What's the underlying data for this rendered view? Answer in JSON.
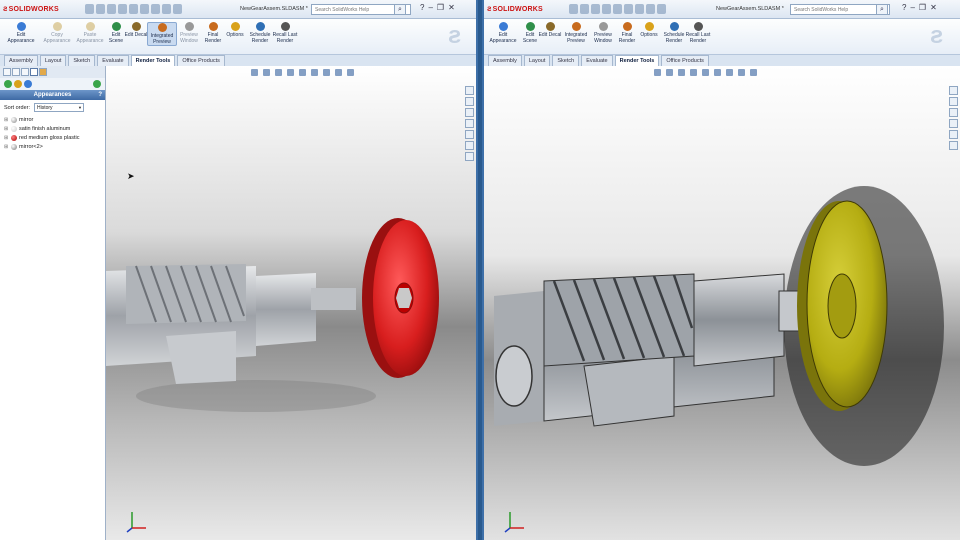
{
  "left": {
    "brand": "SOLIDWORKS",
    "doc_title": "NewGearAssem.SLDASM *",
    "search_placeholder": "Search SolidWorks Help",
    "ribbon": [
      {
        "label": "Edit Appearance",
        "state": "normal",
        "icon_color": "#3a7bd5"
      },
      {
        "label": "Copy Appearance",
        "state": "disabled",
        "icon_color": "#c3a24a"
      },
      {
        "label": "Paste Appearance",
        "state": "disabled",
        "icon_color": "#c3a24a"
      },
      {
        "label": "Edit Scene",
        "state": "normal",
        "icon_color": "#2f8f4a"
      },
      {
        "label": "Edit Decal",
        "state": "normal",
        "icon_color": "#8a6a2a"
      },
      {
        "label": "Integrated Preview",
        "state": "active",
        "icon_color": "#c86b1e"
      },
      {
        "label": "Preview Window",
        "state": "disabled",
        "icon_color": "#999999"
      },
      {
        "label": "Final Render",
        "state": "normal",
        "icon_color": "#c86b1e"
      },
      {
        "label": "Options",
        "state": "normal",
        "icon_color": "#d9a21b"
      },
      {
        "label": "Schedule Render",
        "state": "normal",
        "icon_color": "#2f6fb5"
      },
      {
        "label": "Recall Last Render",
        "state": "normal",
        "icon_color": "#555555"
      }
    ],
    "tabs": [
      "Assembly",
      "Layout",
      "Sketch",
      "Evaluate",
      "Render Tools",
      "Office Products"
    ],
    "active_tab": "Render Tools",
    "panel": {
      "title": "Appearances",
      "help": "?",
      "sort_label": "Sort order:",
      "sort_value": "History",
      "items": [
        {
          "label": "mirror",
          "color": "#b8b8b8"
        },
        {
          "label": "satin finish aluminum",
          "color": "#e0e0e0"
        },
        {
          "label": "red medium gloss plastic",
          "color": "#c21a1a"
        },
        {
          "label": "mirror<2>",
          "color": "#a8a8a8"
        }
      ]
    },
    "colors": {
      "wheel": "#d81e1e",
      "gear": "#b8bcc2"
    }
  },
  "right": {
    "brand": "SOLIDWORKS",
    "doc_title": "NewGearAssem.SLDASM *",
    "search_placeholder": "Search SolidWorks Help",
    "ribbon": [
      {
        "label": "Edit Appearance",
        "state": "normal",
        "icon_color": "#3a7bd5"
      },
      {
        "label": "Edit Scene",
        "state": "normal",
        "icon_color": "#2f8f4a"
      },
      {
        "label": "Edit Decal",
        "state": "normal",
        "icon_color": "#8a6a2a"
      },
      {
        "label": "Integrated Preview",
        "state": "normal",
        "icon_color": "#c86b1e"
      },
      {
        "label": "Preview Window",
        "state": "normal",
        "icon_color": "#999999"
      },
      {
        "label": "Final Render",
        "state": "normal",
        "icon_color": "#c86b1e"
      },
      {
        "label": "Options",
        "state": "normal",
        "icon_color": "#d9a21b"
      },
      {
        "label": "Schedule Render",
        "state": "normal",
        "icon_color": "#2f6fb5"
      },
      {
        "label": "Recall Last Render",
        "state": "normal",
        "icon_color": "#555555"
      }
    ],
    "tabs": [
      "Assembly",
      "Layout",
      "Sketch",
      "Evaluate",
      "Render Tools",
      "Office Products"
    ],
    "active_tab": "Render Tools",
    "colors": {
      "wheel": "#b5ad12",
      "gear": "#9aa0a8"
    }
  }
}
